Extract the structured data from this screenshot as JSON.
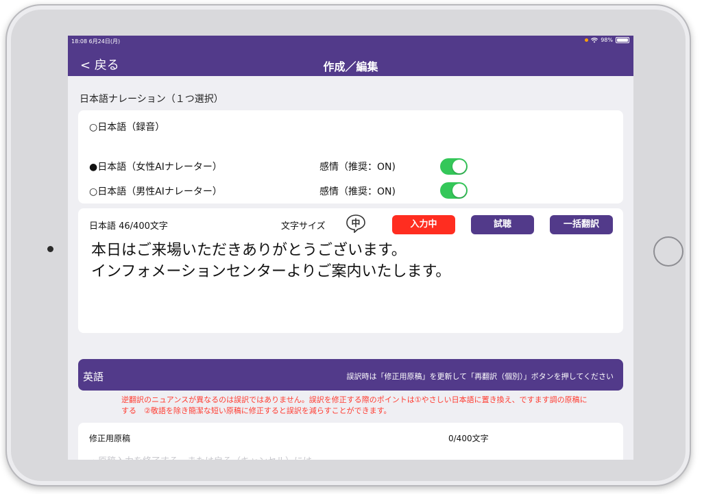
{
  "status": {
    "time": "18:08 6月24日(月)",
    "battery": "98%",
    "battery_level": 0.98
  },
  "nav": {
    "back": "< 戻る",
    "title": "作成／編集"
  },
  "narration": {
    "section_label": "日本語ナレーション（１つ選択）",
    "options": [
      {
        "label": "○日本語（録音）"
      },
      {
        "label": "●日本語（女性AIナレーター）",
        "emotion": "感情（推奨：ON)",
        "toggle_on": true
      },
      {
        "label": "○日本語（男性AIナレーター）",
        "emotion": "感情（推奨：ON)",
        "toggle_on": true
      }
    ]
  },
  "editor": {
    "count": "日本語 46/400文字",
    "font_size_label": "文字サイズ",
    "font_size_icon": "中",
    "input_button": "入力中",
    "listen_button": "試聴",
    "translate_button": "一括翻訳",
    "text": "本日はご来場いただきありがとうございます。\nインフォメーションセンターよりご案内いたします。"
  },
  "english": {
    "title": "英語",
    "hint": "誤訳時は「修正用原稿」を更新して「再翻訳（個別）」ボタンを押してください",
    "warning": "逆翻訳のニュアンスが異なるのは誤訳ではありません。誤訳を修正する際のポイントは①やさしい日本語に置き換え、ですます調の原稿にする　②敬語を除き簡潔な短い原稿に修正すると誤訳を減らすことができます。"
  },
  "fix": {
    "label": "修正用原稿",
    "count": "0/400文字",
    "placeholder": "・原稿入力を終了する、または戻る（キャンセル）には"
  },
  "colors": {
    "accent": "#523a8a",
    "toggle_on": "#34c759",
    "alert": "#ff2d20",
    "warning_text": "#ff3b30"
  }
}
